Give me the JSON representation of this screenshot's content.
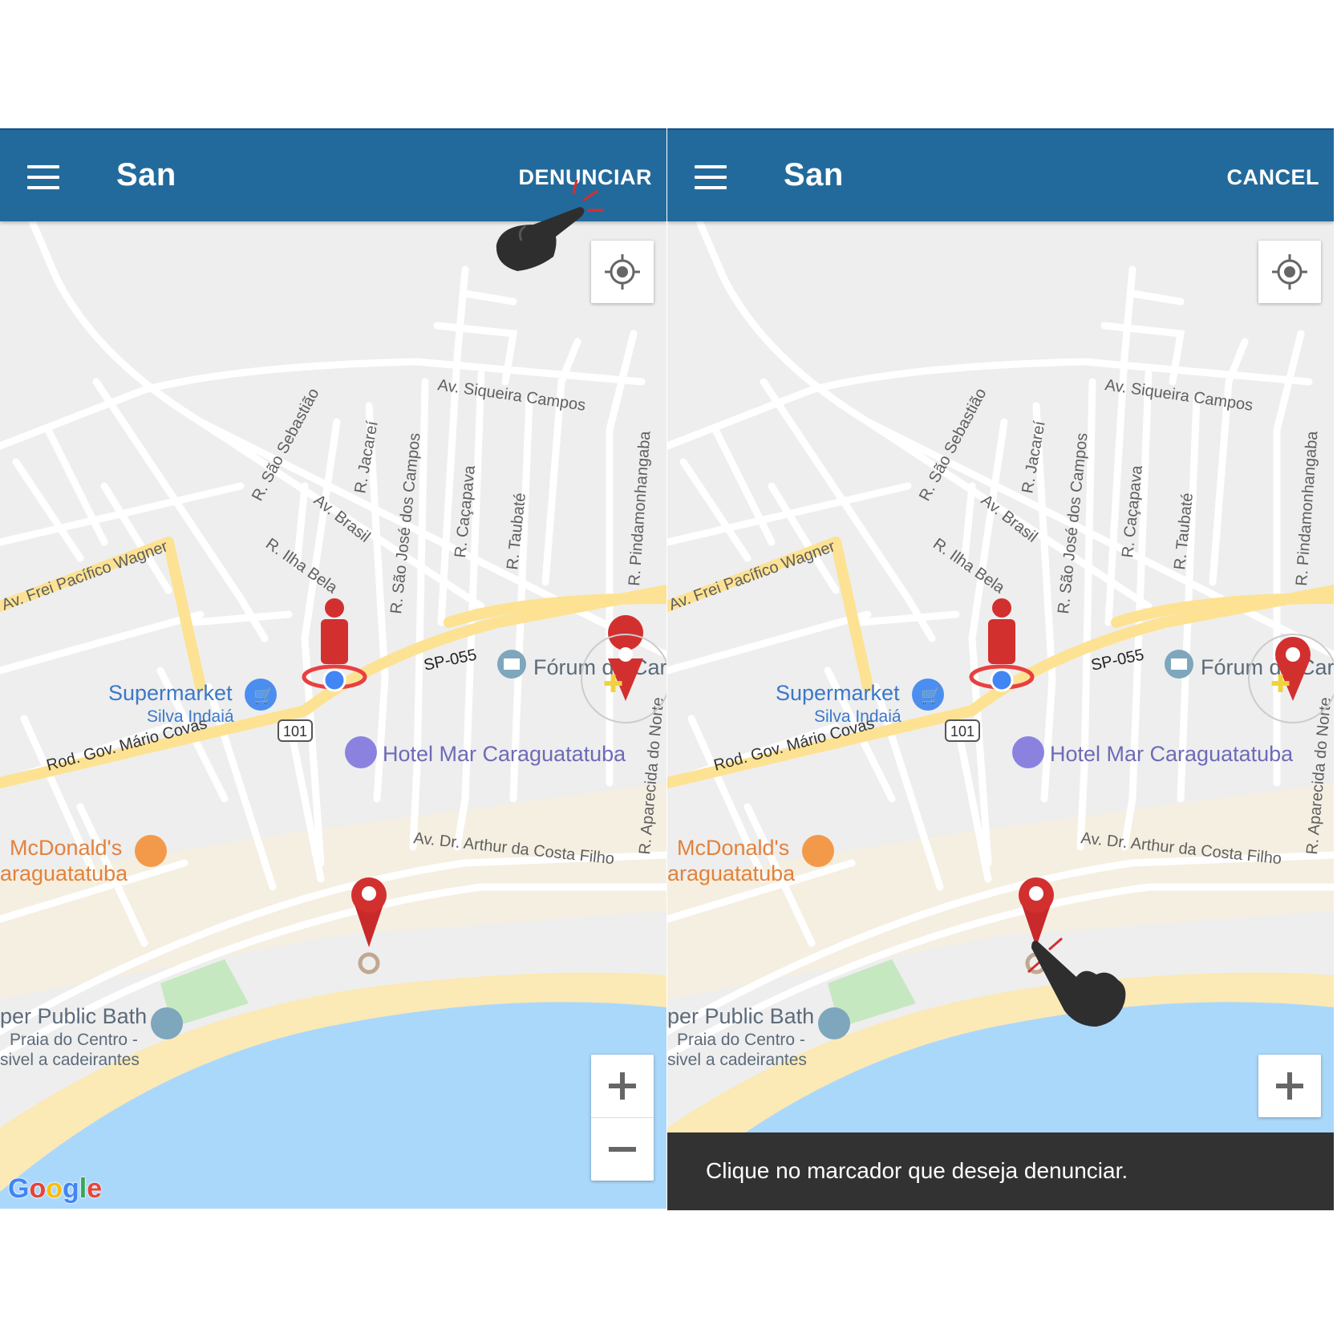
{
  "colors": {
    "appbar": "#236a9c",
    "water": "#aad8fb",
    "beach": "#fbe9b6",
    "highway": "#fde293",
    "road": "#ffffff",
    "land": "#eeeeee",
    "park": "#c5e8c0",
    "marker": "#d2302f",
    "snackbar": "#323232"
  },
  "left": {
    "app_title": "San",
    "action_label": "DENUNCIAR",
    "menu_icon": "hamburger-menu-icon",
    "google_logo": "Google"
  },
  "right": {
    "app_title": "San",
    "action_label": "CANCEL",
    "menu_icon": "hamburger-menu-icon",
    "snackbar_text": "Clique no marcador que deseja denunciar."
  },
  "map": {
    "streets": {
      "siqueira": "Av. Siqueira Campos",
      "sao_sebastiao": "R. São Sebastião",
      "jacarei": "R. Jacareí",
      "sao_jose": "R. São José dos Campos",
      "cacapava": "R. Caçapava",
      "taubate": "R. Taubaté",
      "pinda": "R. Pindamonhangaba",
      "brasil": "Av. Brasil",
      "ilha_bela": "R. Ilha Bela",
      "frei": "Av. Frei Pacífico Wagner",
      "sp055": "SP-055",
      "route101": "101",
      "rod": "Rod. Gov. Mário Covas",
      "arthur": "Av. Dr. Arthur da Costa Filho",
      "aparecida": "R. Aparecida do Norte"
    },
    "places": {
      "forum": "Fórum de Car",
      "supermarket": "Supermarket",
      "supermarket_sub": "Silva Indaiá",
      "hotel": "Hotel Mar Caraguatatuba",
      "mcd1": "McDonald's",
      "mcd2": "araguatatuba",
      "bath1": "per Public Bath",
      "bath2": "Praia do Centro -",
      "bath3": "sivel a cadeirantes"
    }
  }
}
